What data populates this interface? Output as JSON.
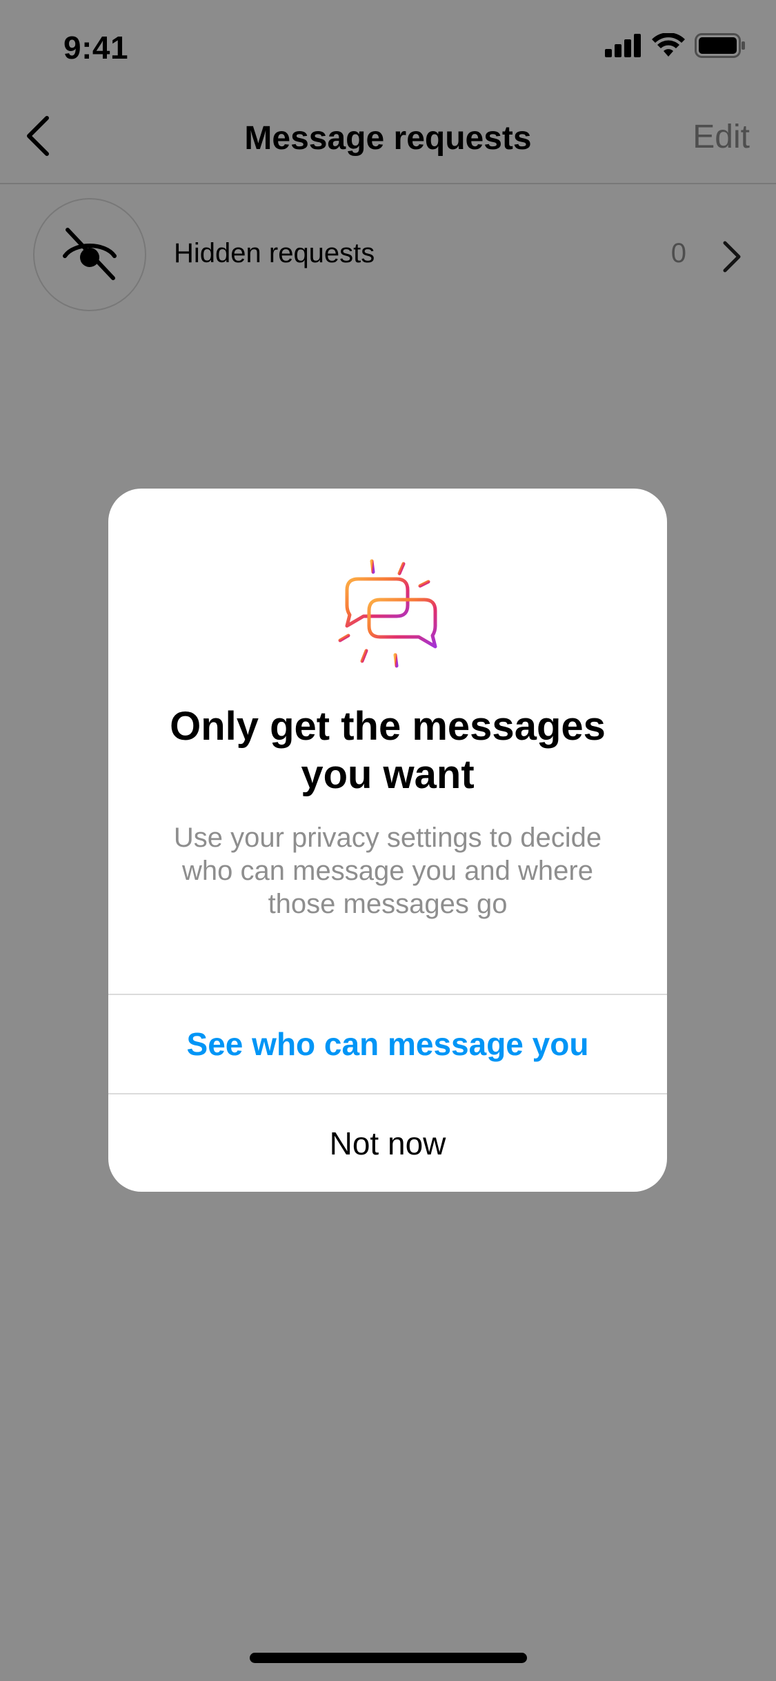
{
  "status_bar": {
    "time": "9:41"
  },
  "nav": {
    "title": "Message requests",
    "edit_label": "Edit",
    "icons": {
      "back": "chevron-left-icon"
    }
  },
  "hidden_requests": {
    "label": "Hidden requests",
    "count": "0",
    "icons": {
      "avatar": "eye-slash-icon",
      "chevron": "chevron-right-icon"
    }
  },
  "dialog": {
    "illustration_icon": "message-bubbles-icon",
    "title": "Only get the messages you want",
    "body": "Use your privacy settings to decide who can message you and where those messages go",
    "primary_button": "See who can message you",
    "secondary_button": "Not now"
  },
  "colors": {
    "accent": "#0095f6",
    "secondary_text": "#8e8e8e",
    "divider": "#dbdbdb",
    "overlay": "rgba(0,0,0,0.45)"
  }
}
